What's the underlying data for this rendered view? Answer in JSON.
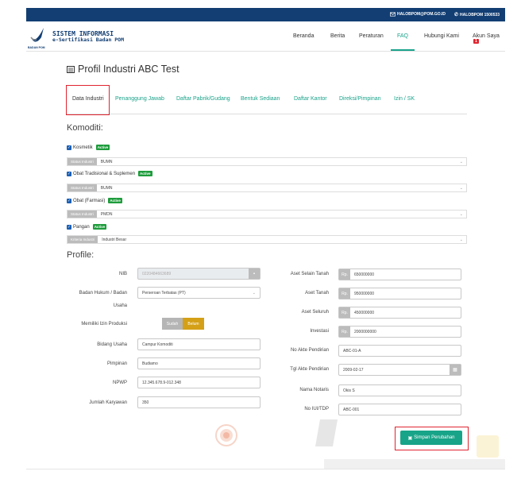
{
  "topbar": {
    "email": "HALOBPOM@POM.GO.ID",
    "phone": "HALOBPOM 1500533"
  },
  "brand": {
    "title": "SISTEM INFORMASI",
    "subtitle": "e-Sertifikasi Badan POM",
    "small": "BADAN POM"
  },
  "nav": {
    "items": [
      "Beranda",
      "Berita",
      "Peraturan",
      "FAQ",
      "Hubungi Kami",
      "Akun Saya"
    ],
    "active": "FAQ",
    "account_badge": "1"
  },
  "page": {
    "title": "Profil Industri ABC Test"
  },
  "tabs": [
    "Data Industri",
    "Penanggung Jawab",
    "Daftar Pabrik/Gudang",
    "Bentuk Sediaan",
    "Daftar Kantor",
    "Direksi/Pimpinan",
    "Izin / SK"
  ],
  "komoditi": {
    "heading": "Komoditi:",
    "items": [
      {
        "label": "Kosmetik",
        "badge": "Active",
        "addon": "Status Industri",
        "value": "BUMN"
      },
      {
        "label": "Obat Tradisional & Suplemen",
        "badge": "Active",
        "addon": "Status Industri",
        "value": "BUMN"
      },
      {
        "label": "Obat (Farmasi)",
        "badge": "Active",
        "addon": "Status Industri",
        "value": "PMDN"
      },
      {
        "label": "Pangan",
        "badge": "Active",
        "addon": "Kriteria Industri",
        "value": "Industri Besar"
      }
    ]
  },
  "profile": {
    "heading": "Profile:",
    "nib_label": "NIB",
    "nib_value": "0220484663689",
    "badan_hukum_label_1": "Badan Hukum / Badan",
    "badan_hukum_label_2": "Usaha",
    "badan_hukum_value": "Perseroan Terbatas (PT)",
    "izin_label": "Memiliki Izin Produksi",
    "izin_sudah": "Sudah",
    "izin_belum": "Belum",
    "bidang_label": "Bidang Usaha",
    "bidang_value": "Campur Komoditi",
    "pimpinan_label": "Pimpinan",
    "pimpinan_value": "Budiamo",
    "npwp_label": "NPWP",
    "npwp_value": "12.345.678.9-012.348",
    "karyawan_label": "Jumlah Karyawan",
    "karyawan_value": "350",
    "rp": "Rp.",
    "aset_selain_label": "Aset Selain Tanah",
    "aset_selain_value": "650000000",
    "aset_tanah_label": "Aset Tanah",
    "aset_tanah_value": "950000000",
    "aset_seluruh_label": "Aset Seluruh",
    "aset_seluruh_value": "450000000",
    "investasi_label": "Investasi",
    "investasi_value": "2000000000",
    "akte_label": "No Akte Pendirian",
    "akte_value": "ABC-01-A",
    "tgl_label": "Tgl Akte Pendirian",
    "tgl_value": "2009-02-17",
    "notaris_label": "Nama Notaris",
    "notaris_value": "Okis S",
    "iui_label": "No IUI/TDP",
    "iui_value": "ABC-001"
  },
  "save_button": "Simpan Perubahan",
  "colors": {
    "brand": "#123e73",
    "accent": "#18a488",
    "highlight": "#e0242f",
    "active_badge": "#1e9c3c",
    "yellow_toggle": "#d4a017"
  }
}
